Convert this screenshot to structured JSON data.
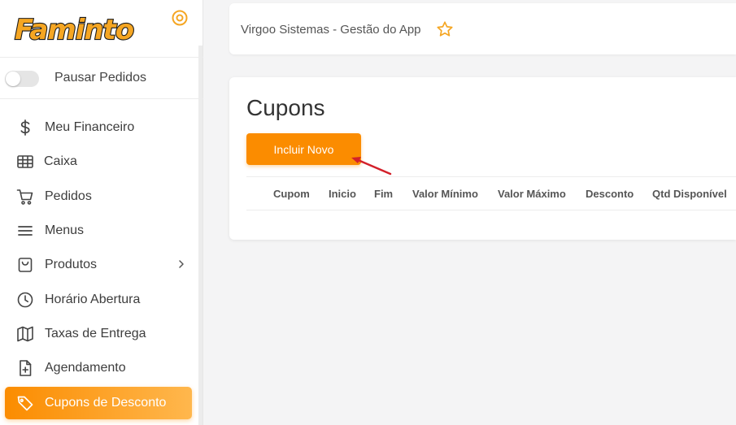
{
  "brand": {
    "logo_text": "Faminto",
    "logo_color": "#f5a623",
    "accent": "#fb8c00"
  },
  "sidebar": {
    "settings_icon": "settings-target-icon",
    "pause_toggle": {
      "label": "Pausar Pedidos",
      "checked": false
    },
    "items": [
      {
        "label": "Meu Financeiro",
        "icon": "dollar-icon"
      },
      {
        "label": "Caixa",
        "icon": "table-grid-icon"
      },
      {
        "label": "Pedidos",
        "icon": "cart-icon"
      },
      {
        "label": "Menus",
        "icon": "menu-lines-icon"
      },
      {
        "label": "Produtos",
        "icon": "bag-icon",
        "has_submenu": true
      },
      {
        "label": "Horário Abertura",
        "icon": "clock-icon"
      },
      {
        "label": "Taxas de Entrega",
        "icon": "map-icon"
      },
      {
        "label": "Agendamento",
        "icon": "file-plus-icon"
      },
      {
        "label": "Cupons de Desconto",
        "icon": "tag-icon",
        "active": true
      }
    ]
  },
  "topbar": {
    "title": "Virgoo Sistemas - Gestão do App",
    "favorite_icon": "star-icon"
  },
  "main": {
    "title": "Cupons",
    "add_button_label": "Incluir Novo",
    "table": {
      "columns": [
        "Cupom",
        "Inicio",
        "Fim",
        "Valor Mínimo",
        "Valor Máximo",
        "Desconto",
        "Qtd Disponível"
      ],
      "rows": []
    }
  }
}
